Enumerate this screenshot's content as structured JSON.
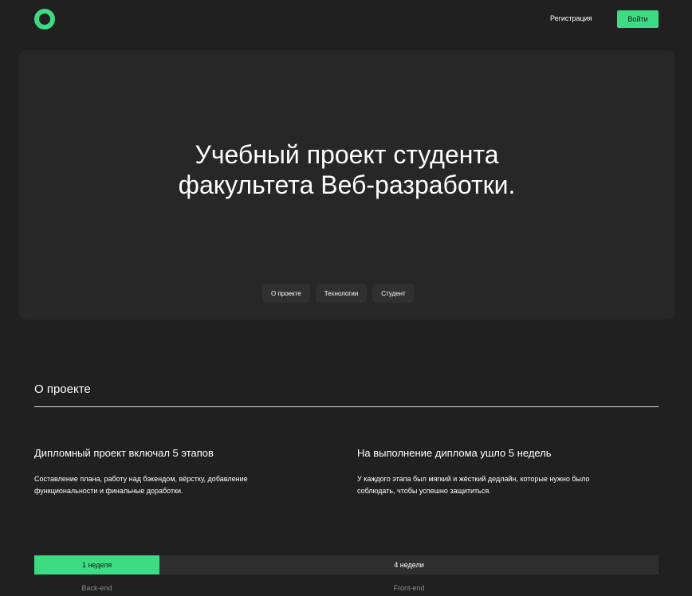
{
  "header": {
    "logo_icon": "ring-logo",
    "register_label": "Регистрация",
    "login_label": "Войти",
    "accent_color": "#3ddc84"
  },
  "hero": {
    "title": "Учебный проект студента\nфакультета Веб-разработки.",
    "tabs": [
      {
        "label": "О проекте"
      },
      {
        "label": "Технологии"
      },
      {
        "label": "Студент"
      }
    ]
  },
  "about": {
    "title": "О проекте",
    "columns": [
      {
        "heading": "Дипломный проект включал 5 этапов",
        "text": "Составление плана, работу над бэкендом, вёрстку, добавление функциональности и финальные доработки."
      },
      {
        "heading": "На выполнение диплома ушло 5 недель",
        "text": "У каждого этапа был мягкий и жёсткий дедлайн, которые нужно было соблюдать, чтобы успешно защититься."
      }
    ],
    "timeline": {
      "backend_duration": "1 неделя",
      "frontend_duration": "4 недели",
      "backend_label": "Back-end",
      "frontend_label": "Front-end"
    }
  }
}
